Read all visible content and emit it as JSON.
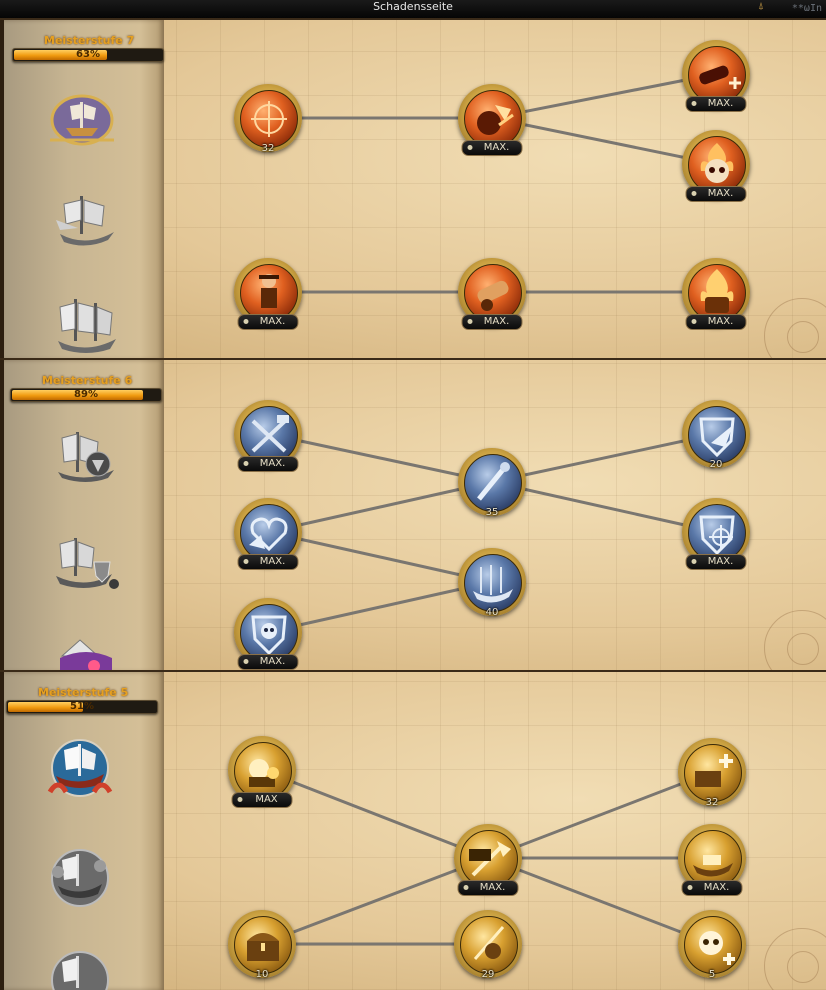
{
  "title": "Schadensseite",
  "logo_text": "**ωIn",
  "panels": [
    {
      "label": "Meisterstufe 7",
      "progress": 63,
      "progress_text": "63%",
      "nodes": [
        {
          "badge": "32"
        },
        {
          "badge": "MAX."
        },
        {
          "badge": "MAX."
        },
        {
          "badge": "MAX."
        },
        {
          "badge": "MAX."
        },
        {
          "badge": "MAX."
        },
        {
          "badge": "MAX."
        }
      ]
    },
    {
      "label": "Meisterstufe 6",
      "progress": 89,
      "progress_text": "89%",
      "nodes": [
        {
          "badge": "MAX."
        },
        {
          "badge": "MAX."
        },
        {
          "badge": "MAX."
        },
        {
          "badge": "35"
        },
        {
          "badge": "40"
        },
        {
          "badge": "20"
        },
        {
          "badge": "MAX."
        }
      ]
    },
    {
      "label": "Meisterstufe 5",
      "progress": 51,
      "progress_text": "51%",
      "nodes": [
        {
          "badge": "MAX"
        },
        {
          "badge": "10"
        },
        {
          "badge": "MAX."
        },
        {
          "badge": "29"
        },
        {
          "badge": "32"
        },
        {
          "badge": "MAX."
        },
        {
          "badge": "5"
        }
      ]
    }
  ],
  "colors": {
    "accent": "#e6a020",
    "progress_fill": "#f09a10",
    "badge_bg": "#111111"
  }
}
